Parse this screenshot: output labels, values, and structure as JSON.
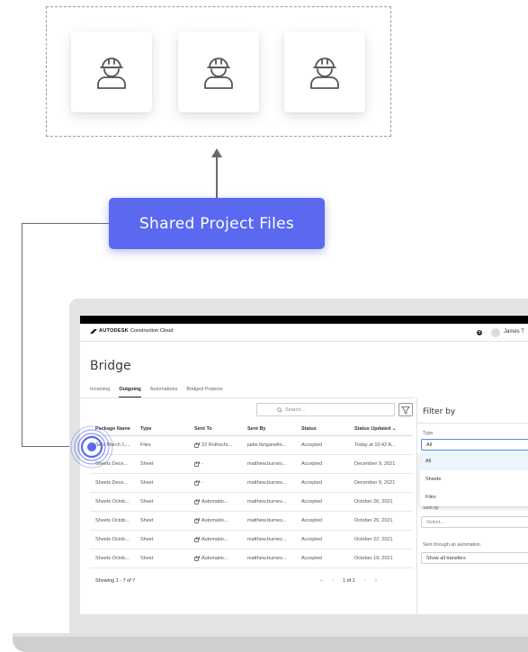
{
  "diagram": {
    "worker_icons": [
      "construction-worker-icon",
      "construction-worker-icon",
      "construction-worker-icon"
    ],
    "shared_button_label": "Shared Project Files",
    "accent_color": "#5b69f0"
  },
  "app": {
    "brand": "AUTODESK",
    "brand_product": "Construction Cloud",
    "user_name": "James T",
    "page_title": "Bridge",
    "tabs": [
      {
        "label": "Incoming",
        "active": false
      },
      {
        "label": "Outgoing",
        "active": true
      },
      {
        "label": "Automations",
        "active": false
      },
      {
        "label": "Bridged Projects",
        "active": false
      }
    ],
    "search_placeholder": "Search...",
    "columns": [
      "Package Name",
      "Type",
      "Sent To",
      "Sent By",
      "Status",
      "Status Updated"
    ],
    "rows": [
      {
        "name": "Sets March 1,...",
        "type": "Files",
        "sent_to": "22 Rothschi...",
        "sent_by": "jadie.fanganello...",
        "status": "Accepted",
        "updated": "Today at 10:42 A..."
      },
      {
        "name": "Sheets Dece...",
        "type": "Sheet",
        "sent_to": "-",
        "sent_by": "matthew.burnes...",
        "status": "Accepted",
        "updated": "December 9, 2021"
      },
      {
        "name": "Sheets Dece...",
        "type": "Sheet",
        "sent_to": "-",
        "sent_by": "matthew.burnes...",
        "status": "Accepted",
        "updated": "December 9, 2021"
      },
      {
        "name": "Sheets Octob...",
        "type": "Sheet",
        "sent_to": "Automatio...",
        "sent_by": "matthew.burnes...",
        "status": "Accepted",
        "updated": "October 26, 2021"
      },
      {
        "name": "Sheets Octob...",
        "type": "Sheet",
        "sent_to": "Automatio...",
        "sent_by": "matthew.burnes...",
        "status": "Accepted",
        "updated": "October 25, 2021"
      },
      {
        "name": "Sheets Octob...",
        "type": "Sheet",
        "sent_to": "Automatio...",
        "sent_by": "matthew.burnes...",
        "status": "Accepted",
        "updated": "October 22, 2021"
      },
      {
        "name": "Sheets Octob...",
        "type": "Sheet",
        "sent_to": "Automatio...",
        "sent_by": "matthew.burnes...",
        "status": "Accepted",
        "updated": "October 19, 2021"
      }
    ],
    "pager": {
      "showing": "Showing 1 - 7 of 7",
      "page": "1 of 1"
    },
    "filter": {
      "title": "Filter by",
      "type_label": "Type",
      "type_value": "All",
      "type_options": [
        "All",
        "Sheets",
        "Files"
      ],
      "sent_by_label": "Sent by",
      "sent_by_placeholder": "Select...",
      "automation_label": "Sent through an automation",
      "automation_value": "Show all transfers"
    }
  }
}
